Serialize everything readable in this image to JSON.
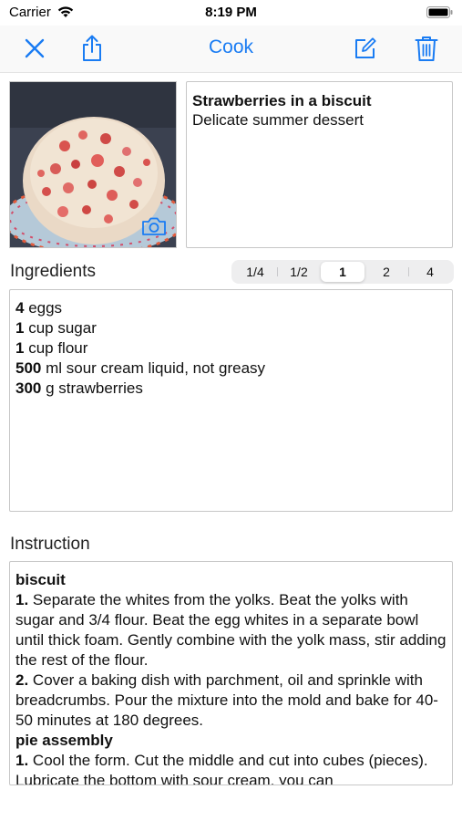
{
  "status_bar": {
    "carrier": "Carrier",
    "time": "8:19 PM"
  },
  "nav": {
    "title": "Cook"
  },
  "recipe": {
    "title": "Strawberries in a biscuit",
    "subtitle": "Delicate summer dessert"
  },
  "ingredients": {
    "label": "Ingredients",
    "portions": [
      "1/4",
      "1/2",
      "1",
      "2",
      "4"
    ],
    "selected_portion": "1",
    "items": [
      {
        "qty": "4",
        "text": " eggs"
      },
      {
        "qty": "1",
        "text": " cup sugar"
      },
      {
        "qty": "1",
        "text": " cup flour"
      },
      {
        "qty": "500",
        "text": " ml sour cream liquid, not greasy"
      },
      {
        "qty": "300",
        "text": " g strawberries"
      }
    ]
  },
  "instruction": {
    "label": "Instruction",
    "sections": [
      {
        "heading": "biscuit",
        "steps": [
          {
            "num": "1.",
            "text": " Separate the whites from the yolks. Beat the yolks with sugar and 3/4 flour. Beat the egg whites in a separate bowl until thick foam. Gently combine with the yolk mass, stir adding the rest of the flour."
          },
          {
            "num": "2.",
            "text": " Cover a baking dish with parchment, oil and sprinkle with breadcrumbs. Pour the mixture into the mold and bake for 40-50 minutes at 180 degrees."
          }
        ]
      },
      {
        "heading": "pie assembly",
        "steps": [
          {
            "num": "1.",
            "text": " Cool the form. Cut the middle and cut into cubes (pieces). Lubricate the bottom with sour cream, you can"
          }
        ]
      }
    ]
  },
  "colors": {
    "accent": "#1a7cf3",
    "border": "#c7c7c7"
  },
  "icons": [
    "close-icon",
    "share-icon",
    "edit-icon",
    "trash-icon",
    "camera-icon",
    "wifi-icon",
    "battery-icon"
  ]
}
